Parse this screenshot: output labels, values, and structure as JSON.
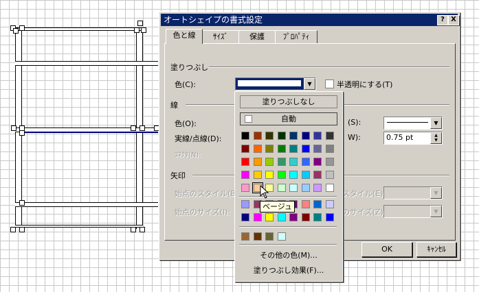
{
  "dialog": {
    "title": "オートシェイプの書式設定",
    "title_buttons": {
      "help": "?",
      "close": "X"
    },
    "tabs": [
      {
        "label": "色と線",
        "active": true
      },
      {
        "label": "ｻｲｽﾞ",
        "active": false
      },
      {
        "label": "保護",
        "active": false
      },
      {
        "label": "ﾌﾟﾛﾊﾟﾃｨ",
        "active": false
      }
    ],
    "fill": {
      "section": "塗りつぶし",
      "color_label": "色(C):",
      "semi_transparent_label": "半透明にする(T)"
    },
    "line": {
      "section": "線",
      "color_label": "色(O):",
      "dash_label": "実線/点線(D):",
      "connector_label": "ｺﾈｸﾀ(N):",
      "style_suffix": "(S):",
      "weight_suffix": "W):",
      "weight_value": "0.75 pt"
    },
    "arrows": {
      "section": "矢印",
      "begin_style_label": "始点のスタイル(B):",
      "begin_size_label": "始点のサイズ(I):",
      "end_style_label": "スタイル(E):",
      "end_size_label": "のサイズ(Z):"
    },
    "buttons": {
      "ok": "OK",
      "cancel": "ｷｬﾝｾﾙ"
    }
  },
  "color_popup": {
    "no_fill": "塗りつぶしなし",
    "automatic": "自動",
    "main_colors": [
      [
        "#000000",
        "#993300",
        "#333300",
        "#003300",
        "#003366",
        "#000080",
        "#333399",
        "#333333"
      ],
      [
        "#800000",
        "#ff6600",
        "#808000",
        "#008000",
        "#008080",
        "#0000ff",
        "#666699",
        "#808080"
      ],
      [
        "#ff0000",
        "#ff9900",
        "#99cc00",
        "#339966",
        "#33cccc",
        "#3366ff",
        "#800080",
        "#969696"
      ],
      [
        "#ff00ff",
        "#ffcc00",
        "#ffff00",
        "#00ff00",
        "#00ffff",
        "#00ccff",
        "#993366",
        "#c0c0c0"
      ],
      [
        "#ff99cc",
        "#ffcc99",
        "#ffff99",
        "#ccffcc",
        "#ccffff",
        "#99ccff",
        "#cc99ff",
        "#ffffff"
      ]
    ],
    "chart_colors": [
      [
        "#9999ff",
        "#993366",
        "#ffffcc",
        "#ccffff",
        "#660066",
        "#ff8080",
        "#0066cc",
        "#ccccff"
      ],
      [
        "#000080",
        "#ff00ff",
        "#ffff00",
        "#00ffff",
        "#800080",
        "#800000",
        "#008080",
        "#0000ff"
      ]
    ],
    "recent_colors": [
      "#996633",
      "#663300",
      "#666633",
      "#ccffff"
    ],
    "more_colors": "その他の色(M)...",
    "fill_effects": "塗りつぶし効果(F)...",
    "tooltip": "ベージュ"
  }
}
